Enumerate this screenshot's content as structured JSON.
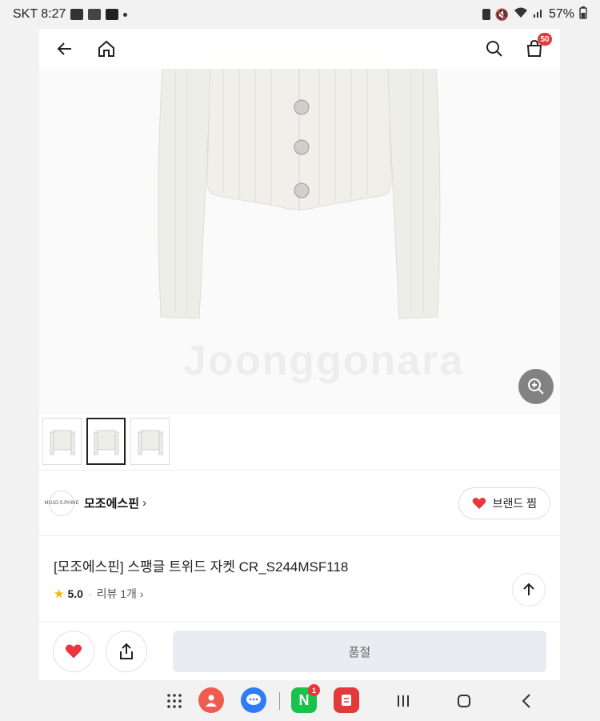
{
  "status_bar": {
    "carrier_time": "SKT 8:27",
    "battery": "57%",
    "app_icon_label": "Naver Club"
  },
  "nav": {
    "cart_count": "50"
  },
  "brand": {
    "logo_text": "MOJO.S.PHINE",
    "name": "모조에스핀",
    "chevron": "›",
    "fav_label": "브랜드 찜"
  },
  "product": {
    "title": "[모조에스핀] 스팽글 트위드 자켓 CR_S244MSF118",
    "rating": "5.0",
    "review_label": "리뷰 1개",
    "separator": "·",
    "review_chevron": "›"
  },
  "actions": {
    "soldout_label": "품절"
  },
  "android_nav": {
    "naver_badge": "1",
    "naver_letter": "N"
  },
  "colors": {
    "accent_red": "#e8383d",
    "soldout_bg": "#e9ecf0"
  }
}
